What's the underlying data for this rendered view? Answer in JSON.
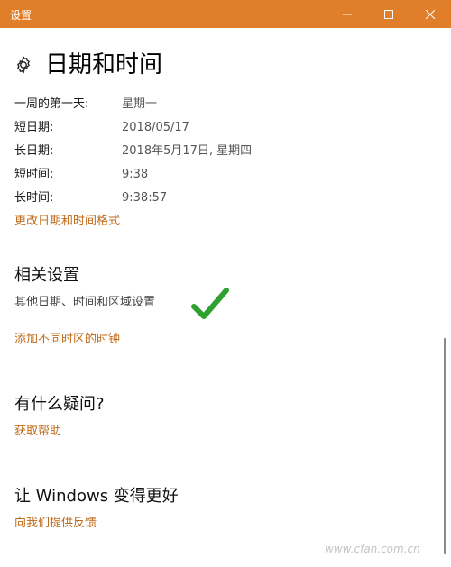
{
  "window": {
    "title": "设置"
  },
  "page": {
    "title": "日期和时间"
  },
  "formats": [
    {
      "label": "一周的第一天:",
      "value": "星期一"
    },
    {
      "label": "短日期:",
      "value": "2018/05/17"
    },
    {
      "label": "长日期:",
      "value": "2018年5月17日, 星期四"
    },
    {
      "label": "短时间:",
      "value": "9:38"
    },
    {
      "label": "长时间:",
      "value": "9:38:57"
    }
  ],
  "links": {
    "change_formats": "更改日期和时间格式",
    "add_clocks": "添加不同时区的时钟",
    "get_help": "获取帮助",
    "give_feedback": "向我们提供反馈"
  },
  "related": {
    "title": "相关设置",
    "item": "其他日期、时间和区域设置"
  },
  "help": {
    "title": "有什么疑问?"
  },
  "improve": {
    "title": "让 Windows 变得更好"
  },
  "watermark": "www.cfan.com.cn",
  "colors": {
    "titlebar": "#e07e2a",
    "link": "#c06a18",
    "check": "#2ea02e"
  }
}
